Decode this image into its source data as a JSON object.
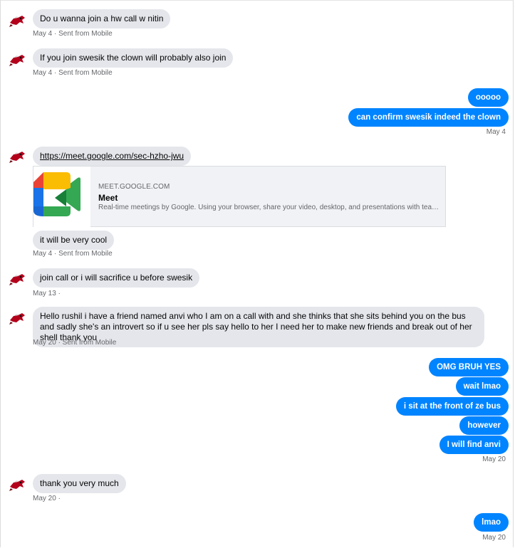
{
  "conversation": {
    "messages": [
      {
        "text": "Do u wanna join a hw call w nitin",
        "meta": "May 4 · Sent from Mobile"
      },
      {
        "text": "If you join swesik the clown will probably also join",
        "meta": "May 4 · Sent from Mobile"
      },
      {
        "text": "ooooo"
      },
      {
        "text": "can confirm swesik indeed the clown",
        "meta": "May 4"
      },
      {
        "text": "https://meet.google.com/sec-hzho-jwu"
      },
      {
        "text": "it will be very cool",
        "meta": "May 4 · Sent from Mobile"
      },
      {
        "text": "join call or i will sacrifice u before swesik",
        "meta": "May 13 ·"
      },
      {
        "text": "Hello rushil i have a friend named anvi who I am on a call with and she thinks that she sits behind you on the bus and sadly she's an introvert so if u see her pls say hello to her I need her to make new friends and break out of her shell thank you",
        "meta": "May 20 · Sent from Mobile"
      },
      {
        "text": "OMG BRUH YES"
      },
      {
        "text": "wait lmao"
      },
      {
        "text": "i sit at the front of ze bus"
      },
      {
        "text": "however"
      },
      {
        "text": "I will find anvi",
        "meta": "May 20"
      },
      {
        "text": "thank you very much",
        "meta": "May 20 ·"
      },
      {
        "text": "lmao",
        "meta": "May 20"
      }
    ],
    "link_preview": {
      "domain": "MEET.GOOGLE.COM",
      "title": "Meet",
      "description": "Real-time meetings by Google. Using your browser, share your video, desktop, and presentations with teamm…",
      "icon": "google-meet-icon"
    }
  },
  "colors": {
    "outgoing_bubble": "#0084ff",
    "incoming_bubble": "#e4e6eb",
    "meta_text": "#65676b"
  }
}
